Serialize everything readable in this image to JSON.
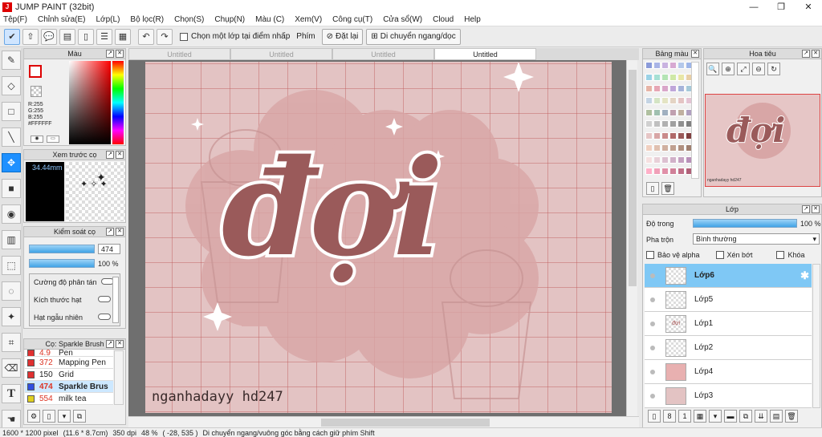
{
  "window": {
    "title": "JUMP PAINT (32bit)",
    "minimize": "—",
    "restore": "❐",
    "close": "✕",
    "app_icon": "J"
  },
  "menu": [
    "Tệp(F)",
    "Chỉnh sửa(E)",
    "Lớp(L)",
    "Bộ lọc(R)",
    "Chọn(S)",
    "Chụp(N)",
    "Màu (C)",
    "Xem(V)",
    "Công cụ(T)",
    "Cửa sổ(W)",
    "Cloud",
    "Help"
  ],
  "toolbar": {
    "select_layer_label": "Chọn một lớp tại điểm nhấp",
    "key_label": "Phím",
    "reset_label": "Đặt lại",
    "move_label": "Di chuyển ngang/dọc"
  },
  "color_panel": {
    "title": "Màu",
    "r": "R:255",
    "g": "G:255",
    "b": "B:255",
    "hex": "#FFFFFF"
  },
  "brush_preview": {
    "title": "Xem trước cọ",
    "size": "34.44mm"
  },
  "brush_control": {
    "title": "Kiểm soát cọ",
    "size_value": "474",
    "opacity_value": "100 %",
    "options": [
      "Cường độ phân tán",
      "Kích thước hạt",
      "Hạt ngẫu nhiên"
    ]
  },
  "brush_list": {
    "title": "Cọ: Sparkle Brush",
    "items": [
      {
        "num": "4.9",
        "name": "Pen",
        "color": "#e03030"
      },
      {
        "num": "372",
        "name": "Mapping Pen",
        "color": "#e03030"
      },
      {
        "num": "150",
        "name": "Grid",
        "color": "#e03030"
      },
      {
        "num": "474",
        "name": "Sparkle Brus",
        "color": "#3050e0"
      },
      {
        "num": "554",
        "name": "milk tea",
        "color": "#e0d020"
      }
    ]
  },
  "tabs": [
    "Untitled",
    "Untitled",
    "Untitled",
    "Untitled"
  ],
  "canvas": {
    "title_text": "đợi",
    "signature": "nganhadayy hd247"
  },
  "palette_panel": {
    "title": "Bảng màu"
  },
  "navigator": {
    "title": "Hoa tiêu",
    "thumb_text": "đợi",
    "thumb_sig": "nganhadayy hd247"
  },
  "layer_panel": {
    "title": "Lớp",
    "opacity_label": "Độ trong",
    "opacity_value": "100 %",
    "blend_label": "Pha trộn",
    "blend_value": "Bình thường",
    "protect_alpha": "Bảo vệ alpha",
    "clip": "Xén bớt",
    "lock": "Khóa",
    "layers": [
      {
        "name": "Lớp6",
        "thumb": ""
      },
      {
        "name": "Lớp5",
        "thumb": ""
      },
      {
        "name": "Lớp1",
        "thumb": "đợi"
      },
      {
        "name": "Lớp2",
        "thumb": ""
      },
      {
        "name": "Lớp4",
        "thumb": ""
      },
      {
        "name": "Lớp3",
        "thumb": ""
      }
    ]
  },
  "status": {
    "size": "1600 * 1200 pixel",
    "physical": "(11.6 * 8.7cm)",
    "dpi": "350 dpi",
    "zoom": "48 %",
    "coords": "( -28, 535 )",
    "hint": "Di chuyển ngang/vuông góc bằng cách giữ phím Shift"
  },
  "colors": {
    "accent": "#1e90ff",
    "canvas_bg": "#e3c3c3",
    "title_fill": "#9a5a5a"
  }
}
